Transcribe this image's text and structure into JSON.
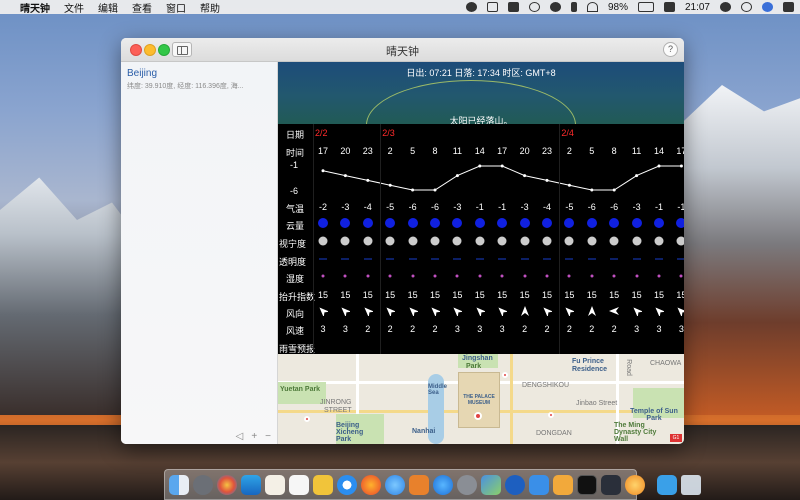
{
  "menubar": {
    "apple": "",
    "app_name": "晴天钟",
    "menus": [
      "文件",
      "编辑",
      "查看",
      "窗口",
      "帮助"
    ],
    "battery": "98%",
    "time": "21:07"
  },
  "window": {
    "title": "晴天钟",
    "help": "?"
  },
  "sidebar": {
    "location_name": "Beijing",
    "location_coords": "纬度: 39.910度, 经度: 116.396度, 海...",
    "footer": [
      "◁",
      "+",
      "−"
    ]
  },
  "sun": {
    "info": "日出:  07:21  日落:  17:34  时区:  GMT+8",
    "message": "太阳已经落山。"
  },
  "row_labels": {
    "date": "日期",
    "time": "时间",
    "temp_max": "-1",
    "temp_min": "-6",
    "temperature": "气温",
    "cloud": "云量",
    "seeing": "视宁度",
    "transparency": "透明度",
    "humidity": "湿度",
    "lifted_index": "抬升指数",
    "wind_direction": "风向",
    "wind_speed": "风速",
    "precipitation": "雨雪预报"
  },
  "dates": [
    {
      "label": "2/2",
      "col": 0
    },
    {
      "label": "2/3",
      "col": 3
    },
    {
      "label": "2/4",
      "col": 11
    }
  ],
  "times": [
    "17",
    "20",
    "23",
    "2",
    "5",
    "8",
    "11",
    "14",
    "17",
    "20",
    "23",
    "2",
    "5",
    "8",
    "11",
    "14",
    "17"
  ],
  "temperature": [
    "-2",
    "-3",
    "-4",
    "-5",
    "-6",
    "-6",
    "-3",
    "-1",
    "-1",
    "-3",
    "-4",
    "-5",
    "-6",
    "-6",
    "-3",
    "-1",
    "-1"
  ],
  "temperature_values": [
    -2,
    -3,
    -4,
    -5,
    -6,
    -6,
    -3,
    -1,
    -1,
    -3,
    -4,
    -5,
    -6,
    -6,
    -3,
    -1,
    -1
  ],
  "temperature_range": [
    -6,
    -1
  ],
  "lifted_index": [
    "15",
    "15",
    "15",
    "15",
    "15",
    "15",
    "15",
    "15",
    "15",
    "15",
    "15",
    "15",
    "15",
    "15",
    "15",
    "15",
    "15"
  ],
  "wind_speed": [
    "3",
    "3",
    "2",
    "2",
    "2",
    "2",
    "3",
    "3",
    "3",
    "2",
    "2",
    "2",
    "2",
    "2",
    "3",
    "3",
    "3"
  ],
  "wind_direction_deg": [
    315,
    315,
    315,
    315,
    315,
    315,
    315,
    315,
    315,
    0,
    315,
    315,
    0,
    270,
    315,
    315,
    315
  ],
  "colors": {
    "cloud": "#1020e0",
    "seeing": "#cccccc",
    "transparency": "#0c1f66",
    "humidity": "#c050c0",
    "date": "#ff2b2b"
  },
  "map": {
    "labels": {
      "jingshan": "Jingshan",
      "park": "Park",
      "palace": "THE PALACE MUSEUM",
      "fu_prince": "Fu Prince",
      "residence": "Residence",
      "yuetan": "Yuetan Park",
      "jinrong": "JINRONG",
      "street": "STREET",
      "middle_sea": "Middle Sea",
      "dengshikou": "DENGSHIKOU",
      "jinbao": "Jinbao Street",
      "chaowai": "CHAOWA",
      "temple_sun": "Temple of Sun Park",
      "beijing_xicheng": "Beijing Xicheng Park",
      "nanhai": "Nanhai",
      "dongdan": "DONGDAN",
      "ming_dynasty": "The Ming Dynasty City Wall",
      "road": "Road",
      "badge": "G1"
    }
  }
}
